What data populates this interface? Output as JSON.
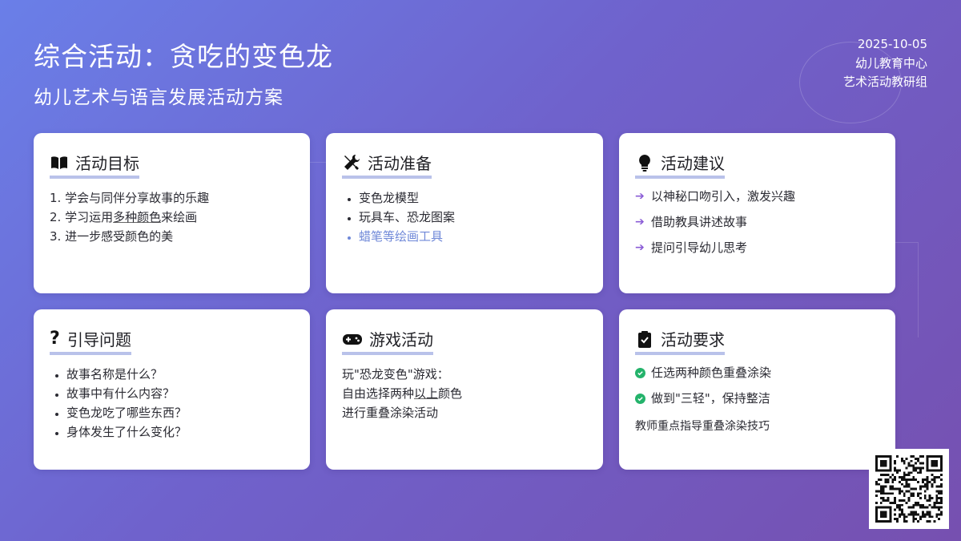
{
  "header": {
    "title": "综合活动：贪吃的变色龙",
    "subtitle": "幼儿艺术与语言发展活动方案",
    "date": "2025-10-05",
    "org": "幼儿教育中心",
    "group": "艺术活动教研组"
  },
  "cards": {
    "goals": {
      "title": "活动目标",
      "icon": "book-icon",
      "items": [
        "1. 学会与同伴分享故事的乐趣",
        "2. 学习运用",
        "多种颜色",
        "来绘画",
        "3. 进一步感受颜色的美"
      ]
    },
    "prep": {
      "title": "活动准备",
      "icon": "tools-icon",
      "items": [
        "变色龙模型",
        "玩具车、恐龙图案",
        "蜡笔等绘画工具"
      ]
    },
    "suggest": {
      "title": "活动建议",
      "icon": "lightbulb-icon",
      "items": [
        "以神秘口吻引入，激发兴趣",
        "借助教具讲述故事",
        "提问引导幼儿思考"
      ]
    },
    "questions": {
      "title": "引导问题",
      "icon": "question-icon",
      "items": [
        "故事名称是什么？",
        "故事中有什么内容？",
        "变色龙吃了哪些东西？",
        "身体发生了什么变化？"
      ]
    },
    "game": {
      "title": "游戏活动",
      "icon": "gamepad-icon",
      "line1": "玩\"恐龙变色\"游戏：",
      "line2a": "自由选择两种",
      "line2b": "以上",
      "line2c": "颜色",
      "line3": "进行重叠涂染活动"
    },
    "require": {
      "title": "活动要求",
      "icon": "clipboard-check-icon",
      "items": [
        "任选两种颜色重叠涂染",
        "做到\"三轻\"，保持整洁"
      ],
      "note": "教师重点指导重叠涂染技巧"
    }
  },
  "colors": {
    "bg_start": "#6a7fe8",
    "bg_end": "#7650b0",
    "underline": "#b9c2ea",
    "arrow": "#8a5cd6",
    "check": "#24b36b",
    "highlight_item": "#6f88d8"
  }
}
